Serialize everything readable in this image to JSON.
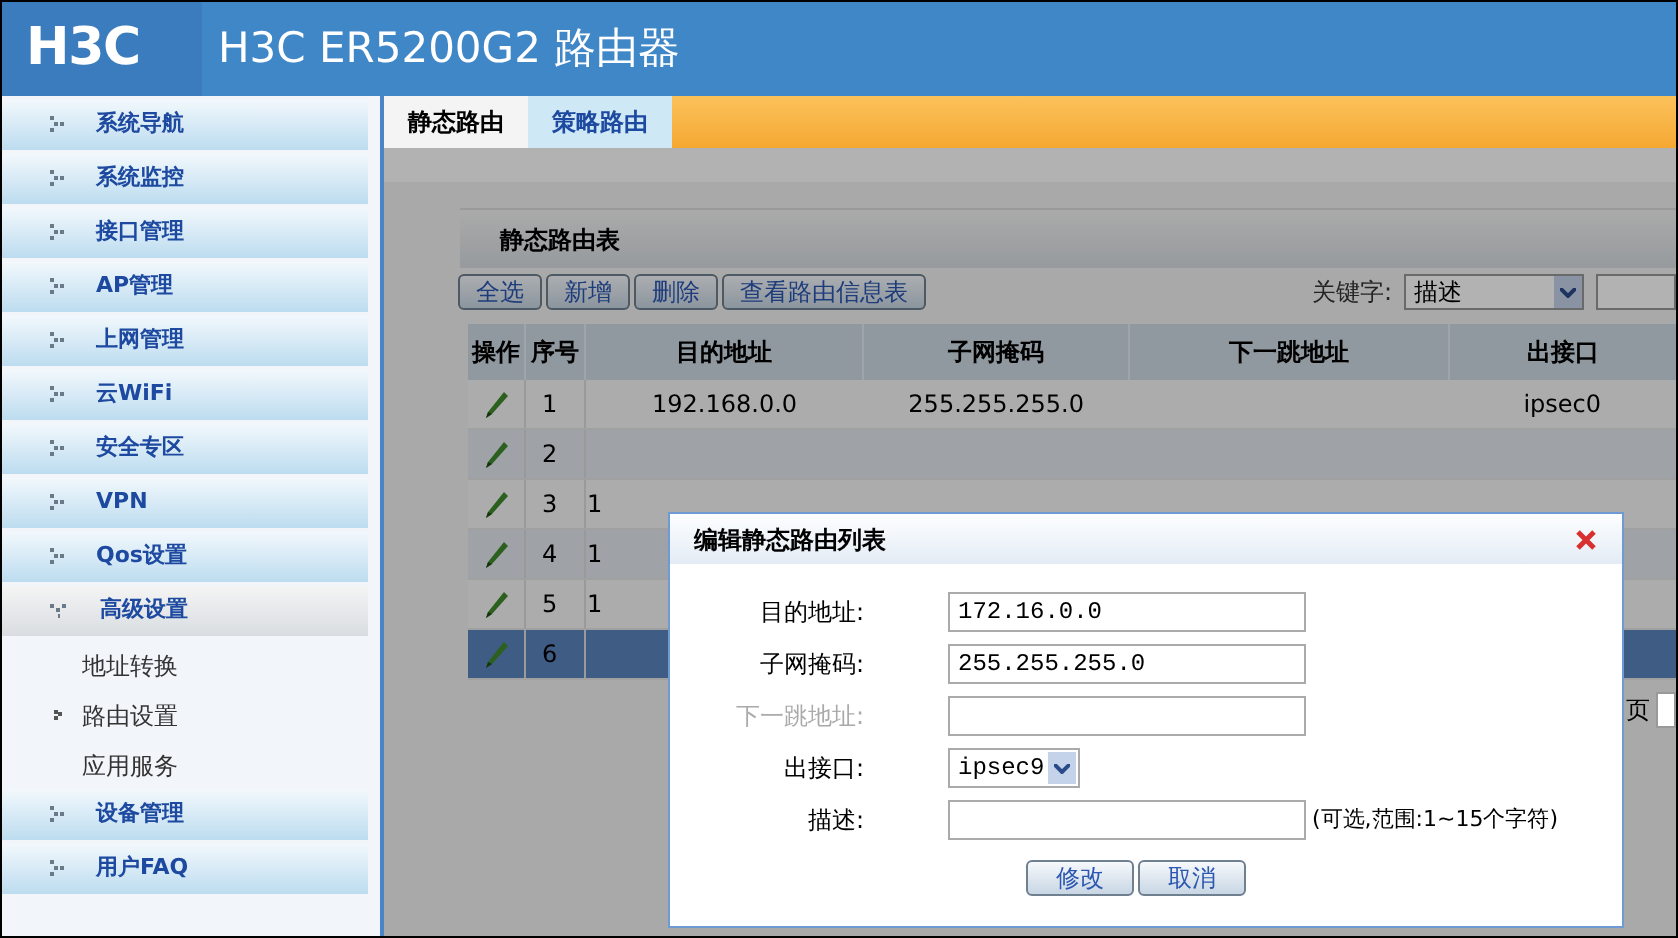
{
  "header": {
    "logo": "H3C",
    "title": "H3C ER5200G2 路由器"
  },
  "sidebar": {
    "items": [
      {
        "label": "系统导航",
        "expanded": false
      },
      {
        "label": "系统监控",
        "expanded": false
      },
      {
        "label": "接口管理",
        "expanded": false
      },
      {
        "label": "AP管理",
        "expanded": false
      },
      {
        "label": "上网管理",
        "expanded": false
      },
      {
        "label": "云WiFi",
        "expanded": false
      },
      {
        "label": "安全专区",
        "expanded": false
      },
      {
        "label": "VPN",
        "expanded": false
      },
      {
        "label": "Qos设置",
        "expanded": false
      },
      {
        "label": "高级设置",
        "expanded": true,
        "children": [
          {
            "label": "地址转换",
            "selected": false
          },
          {
            "label": "路由设置",
            "selected": true
          },
          {
            "label": "应用服务",
            "selected": false
          }
        ]
      },
      {
        "label": "设备管理",
        "expanded": false
      },
      {
        "label": "用户FAQ",
        "expanded": false
      }
    ]
  },
  "tabs": [
    {
      "label": "静态路由",
      "selected": true
    },
    {
      "label": "策略路由",
      "selected": false
    }
  ],
  "panel": {
    "title": "静态路由表",
    "buttons": [
      "全选",
      "新增",
      "删除",
      "查看路由信息表"
    ],
    "keyword_label": "关键字:",
    "keyword_value": "描述"
  },
  "table": {
    "columns": [
      "操作",
      "序号",
      "目的地址",
      "子网掩码",
      "下一跳地址",
      "出接口"
    ],
    "rows": [
      {
        "index": "1",
        "destination": "192.168.0.0",
        "mask": "255.255.255.0",
        "interface": "ipsec0",
        "selected": false
      },
      {
        "index": "2",
        "selected": false
      },
      {
        "index": "3",
        "destination": "1",
        "selected": false
      },
      {
        "index": "4",
        "destination": "1",
        "selected": false
      },
      {
        "index": "5",
        "destination": "1",
        "selected": false
      },
      {
        "index": "6",
        "selected": true
      }
    ]
  },
  "pager": {
    "text": "页"
  },
  "dialog": {
    "title": "编辑静态路由列表",
    "fields": [
      {
        "kind": "text",
        "label": "目的地址:",
        "value": "172.16.0.0",
        "disabled": false
      },
      {
        "kind": "text",
        "label": "子网掩码:",
        "value": "255.255.255.0",
        "disabled": false
      },
      {
        "kind": "text",
        "label": "下一跳地址:",
        "disabled": true
      },
      {
        "kind": "select",
        "label": "出接口:",
        "value": "ipsec9",
        "disabled": false
      },
      {
        "kind": "text",
        "label": "描述:",
        "hint": "(可选,范围:1~15个字符)",
        "disabled": false
      }
    ],
    "buttons": [
      "修改",
      "取消"
    ]
  }
}
